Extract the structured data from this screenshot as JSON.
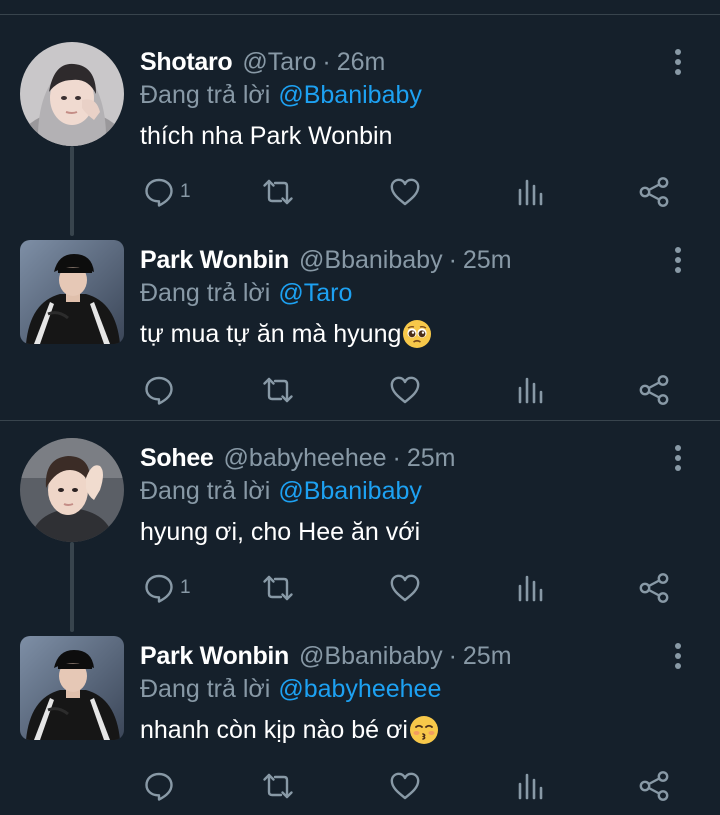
{
  "tweets": [
    {
      "name": "Shotaro",
      "handle": "@Taro",
      "sep": "·",
      "time": "26m",
      "reply_prefix": "Đang trả lời",
      "reply_to": "@Bbanibaby",
      "text": "thích nha Park Wonbin",
      "emoji": "",
      "reply_count": "1",
      "avatar_icon": "profile-photo-gray-hoodie"
    },
    {
      "name": "Park Wonbin",
      "handle": "@Bbanibaby",
      "sep": "·",
      "time": "25m",
      "reply_prefix": "Đang trả lời",
      "reply_to": "@Taro",
      "text": "tự mua tự ăn mà hyung",
      "emoji": "pleading-face-emoji",
      "reply_count": "",
      "avatar_icon": "profile-photo-black-cap-jacket"
    },
    {
      "name": "Sohee",
      "handle": "@babyheehee",
      "sep": "·",
      "time": "25m",
      "reply_prefix": "Đang trả lời",
      "reply_to": "@Bbanibaby",
      "text": "hyung ơi, cho Hee ăn với",
      "emoji": "",
      "reply_count": "1",
      "avatar_icon": "profile-photo-hand-selfie"
    },
    {
      "name": "Park Wonbin",
      "handle": "@Bbanibaby",
      "sep": "·",
      "time": "25m",
      "reply_prefix": "Đang trả lời",
      "reply_to": "@babyheehee",
      "text": "nhanh còn kịp nào bé ơi",
      "emoji": "kissing-face-emoji",
      "reply_count": "",
      "avatar_icon": "profile-photo-black-cap-jacket"
    }
  ],
  "icons": {
    "reply": "reply-icon",
    "retweet": "retweet-icon",
    "like": "heart-icon",
    "stats": "stats-icon",
    "share": "share-icon",
    "more": "more-vertical-icon"
  },
  "colors": {
    "background": "#15202b",
    "divider": "#38444d",
    "text_primary": "#ffffff",
    "text_secondary": "#8899a6",
    "link": "#1da1f2"
  }
}
